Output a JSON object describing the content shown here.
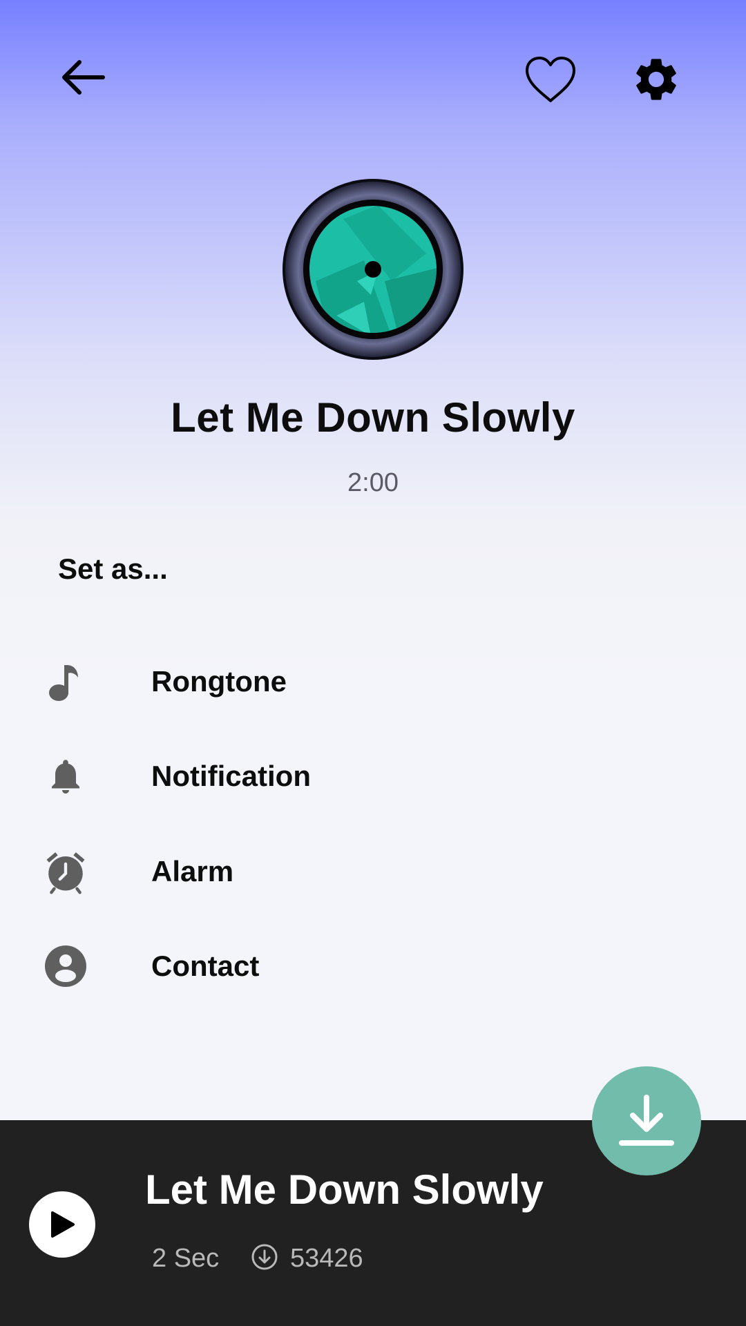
{
  "header": {
    "back_icon": "arrow-left-icon",
    "favorite_icon": "heart-outline-icon",
    "settings_icon": "gear-icon"
  },
  "song": {
    "title": "Let Me Down Slowly",
    "duration": "2:00",
    "artwork_icon": "vinyl-disc-teal"
  },
  "set_as": {
    "heading": "Set as...",
    "options": [
      {
        "label": "Rongtone",
        "icon": "music-note-icon"
      },
      {
        "label": "Notification",
        "icon": "bell-icon"
      },
      {
        "label": "Alarm",
        "icon": "alarm-clock-icon"
      },
      {
        "label": "Contact",
        "icon": "account-circle-icon"
      }
    ]
  },
  "fab": {
    "icon": "download-icon",
    "color": "#72bcab"
  },
  "player": {
    "title": "Let Me Down Slowly",
    "length": "2 Sec",
    "downloads": "53426",
    "play_icon": "play-icon",
    "downloads_icon": "download-circle-icon",
    "background": "#212121"
  },
  "colors": {
    "gradient_top": "#7780ff",
    "background": "#f4f5fa",
    "disc_teal": "#1cbfa6",
    "icon_gray": "#5f5f5f"
  }
}
